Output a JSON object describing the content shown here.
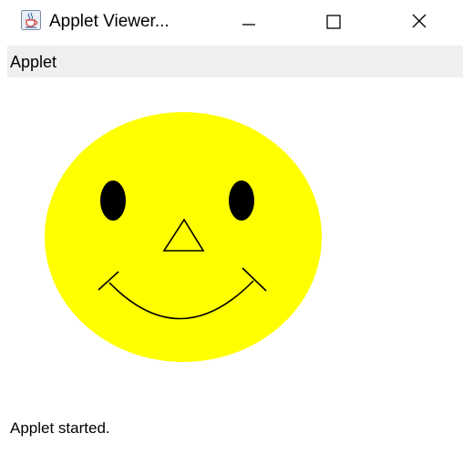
{
  "window": {
    "title": "Applet Viewer...",
    "app_icon": "java-cup-icon",
    "controls": {
      "minimize_icon": "minimize-icon",
      "maximize_icon": "maximize-icon",
      "close_icon": "close-icon"
    }
  },
  "menubar": {
    "items": [
      {
        "label": "Applet"
      }
    ]
  },
  "applet": {
    "drawing": "smiley-face",
    "face_color": "#ffff00",
    "feature_color": "#000000"
  },
  "status": {
    "text": "Applet started."
  }
}
